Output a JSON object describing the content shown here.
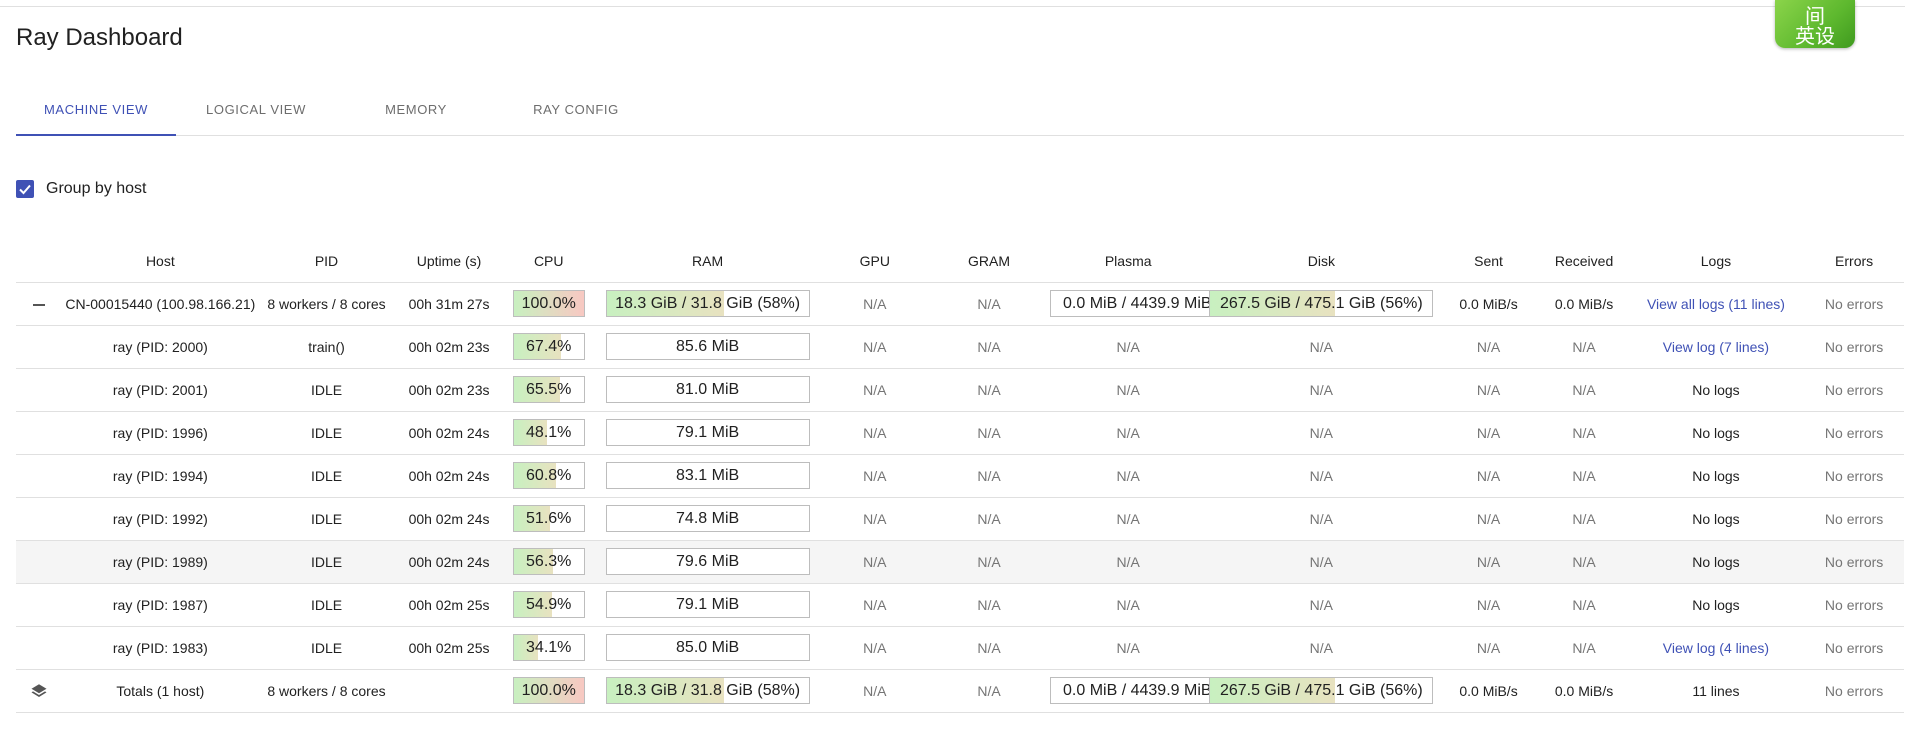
{
  "app": {
    "title": "Ray Dashboard"
  },
  "badge": {
    "line1": "间",
    "line2": "英设"
  },
  "tabs": [
    {
      "label": "MACHINE VIEW",
      "active": true
    },
    {
      "label": "LOGICAL VIEW",
      "active": false
    },
    {
      "label": "MEMORY",
      "active": false
    },
    {
      "label": "RAY CONFIG",
      "active": false
    }
  ],
  "group_by_host": {
    "label": "Group by host",
    "checked": true
  },
  "colors": {
    "accent": "#3f51b5",
    "cpu_high": "#f8c8c2",
    "usage_green": "#c8f0c0"
  },
  "table": {
    "headers": {
      "host": "Host",
      "pid": "PID",
      "uptime": "Uptime (s)",
      "cpu": "CPU",
      "ram": "RAM",
      "gpu": "GPU",
      "gram": "GRAM",
      "plasma": "Plasma",
      "disk": "Disk",
      "sent": "Sent",
      "received": "Received",
      "logs": "Logs",
      "errors": "Errors"
    },
    "host_row": {
      "host": "CN-00015440 (100.98.166.21)",
      "pid": "8 workers / 8 cores",
      "uptime": "00h 31m 27s",
      "cpu": "100.0%",
      "cpu_pct": 100,
      "ram": "18.3 GiB / 31.8 GiB (58%)",
      "ram_pct": 58,
      "gpu": "N/A",
      "gram": "N/A",
      "plasma": "0.0 MiB / 4439.9 MiB",
      "plasma_pct": 0,
      "disk": "267.5 GiB / 475.1 GiB (56%)",
      "disk_pct": 56,
      "sent": "0.0 MiB/s",
      "received": "0.0 MiB/s",
      "logs": "View all logs (11 lines)",
      "errors": "No errors"
    },
    "workers": [
      {
        "host": "ray (PID: 2000)",
        "pid": "train()",
        "uptime": "00h 02m 23s",
        "cpu": "67.4%",
        "cpu_pct": 67.4,
        "ram": "85.6 MiB",
        "gpu": "N/A",
        "gram": "N/A",
        "plasma": "N/A",
        "disk": "N/A",
        "sent": "N/A",
        "received": "N/A",
        "logs": "View log (7 lines)",
        "logs_link": true,
        "errors": "No errors"
      },
      {
        "host": "ray (PID: 2001)",
        "pid": "IDLE",
        "uptime": "00h 02m 23s",
        "cpu": "65.5%",
        "cpu_pct": 65.5,
        "ram": "81.0 MiB",
        "gpu": "N/A",
        "gram": "N/A",
        "plasma": "N/A",
        "disk": "N/A",
        "sent": "N/A",
        "received": "N/A",
        "logs": "No logs",
        "logs_link": false,
        "errors": "No errors"
      },
      {
        "host": "ray (PID: 1996)",
        "pid": "IDLE",
        "uptime": "00h 02m 24s",
        "cpu": "48.1%",
        "cpu_pct": 48.1,
        "ram": "79.1 MiB",
        "gpu": "N/A",
        "gram": "N/A",
        "plasma": "N/A",
        "disk": "N/A",
        "sent": "N/A",
        "received": "N/A",
        "logs": "No logs",
        "logs_link": false,
        "errors": "No errors"
      },
      {
        "host": "ray (PID: 1994)",
        "pid": "IDLE",
        "uptime": "00h 02m 24s",
        "cpu": "60.8%",
        "cpu_pct": 60.8,
        "ram": "83.1 MiB",
        "gpu": "N/A",
        "gram": "N/A",
        "plasma": "N/A",
        "disk": "N/A",
        "sent": "N/A",
        "received": "N/A",
        "logs": "No logs",
        "logs_link": false,
        "errors": "No errors"
      },
      {
        "host": "ray (PID: 1992)",
        "pid": "IDLE",
        "uptime": "00h 02m 24s",
        "cpu": "51.6%",
        "cpu_pct": 51.6,
        "ram": "74.8 MiB",
        "gpu": "N/A",
        "gram": "N/A",
        "plasma": "N/A",
        "disk": "N/A",
        "sent": "N/A",
        "received": "N/A",
        "logs": "No logs",
        "logs_link": false,
        "errors": "No errors"
      },
      {
        "host": "ray (PID: 1989)",
        "pid": "IDLE",
        "uptime": "00h 02m 24s",
        "cpu": "56.3%",
        "cpu_pct": 56.3,
        "ram": "79.6 MiB",
        "gpu": "N/A",
        "gram": "N/A",
        "plasma": "N/A",
        "disk": "N/A",
        "sent": "N/A",
        "received": "N/A",
        "logs": "No logs",
        "logs_link": false,
        "errors": "No errors",
        "hover": true
      },
      {
        "host": "ray (PID: 1987)",
        "pid": "IDLE",
        "uptime": "00h 02m 25s",
        "cpu": "54.9%",
        "cpu_pct": 54.9,
        "ram": "79.1 MiB",
        "gpu": "N/A",
        "gram": "N/A",
        "plasma": "N/A",
        "disk": "N/A",
        "sent": "N/A",
        "received": "N/A",
        "logs": "No logs",
        "logs_link": false,
        "errors": "No errors"
      },
      {
        "host": "ray (PID: 1983)",
        "pid": "IDLE",
        "uptime": "00h 02m 25s",
        "cpu": "34.1%",
        "cpu_pct": 34.1,
        "ram": "85.0 MiB",
        "gpu": "N/A",
        "gram": "N/A",
        "plasma": "N/A",
        "disk": "N/A",
        "sent": "N/A",
        "received": "N/A",
        "logs": "View log (4 lines)",
        "logs_link": true,
        "errors": "No errors"
      }
    ],
    "totals": {
      "host": "Totals (1 host)",
      "pid": "8 workers / 8 cores",
      "uptime": "",
      "cpu": "100.0%",
      "cpu_pct": 100,
      "ram": "18.3 GiB / 31.8 GiB (58%)",
      "ram_pct": 58,
      "gpu": "N/A",
      "gram": "N/A",
      "plasma": "0.0 MiB / 4439.9 MiB",
      "plasma_pct": 0,
      "disk": "267.5 GiB / 475.1 GiB (56%)",
      "disk_pct": 56,
      "sent": "0.0 MiB/s",
      "received": "0.0 MiB/s",
      "logs": "11 lines",
      "errors": "No errors"
    }
  }
}
